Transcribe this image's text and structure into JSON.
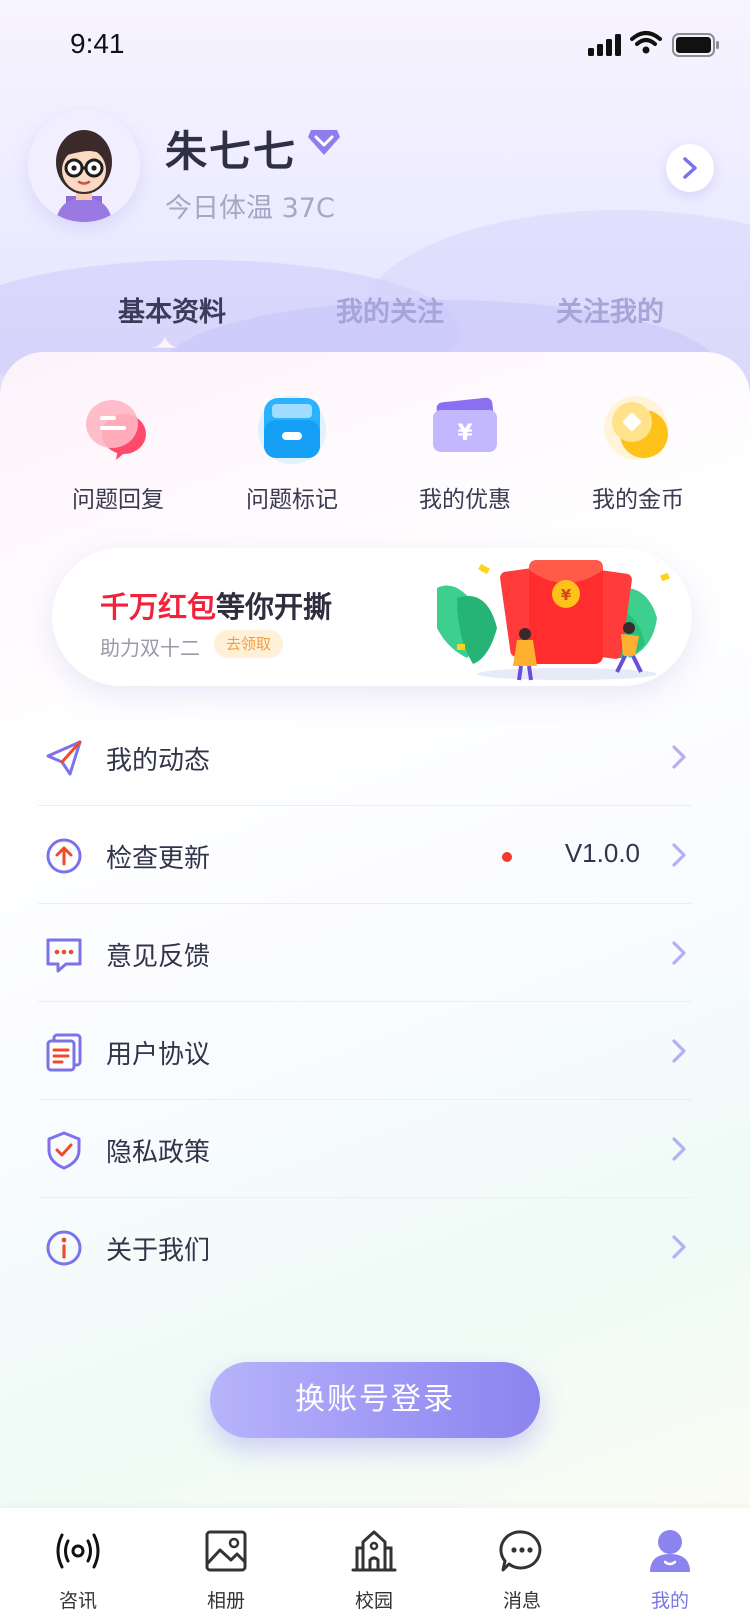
{
  "status_bar": {
    "time": "9:41"
  },
  "profile": {
    "name": "朱七七",
    "temperature": "今日体温 37C"
  },
  "tabs": [
    {
      "label": "基本资料",
      "active": true
    },
    {
      "label": "我的关注",
      "active": false
    },
    {
      "label": "关注我的",
      "active": false
    }
  ],
  "quick_actions": [
    {
      "label": "问题回复",
      "icon": "chat-bubbles-icon"
    },
    {
      "label": "问题标记",
      "icon": "inbox-tray-icon"
    },
    {
      "label": "我的优惠",
      "icon": "coupon-icon"
    },
    {
      "label": "我的金币",
      "icon": "gold-coin-icon"
    }
  ],
  "banner": {
    "title_red": "千万红包",
    "title_rest": "等你开撕",
    "subtitle": "助力双十二",
    "badge": "去领取"
  },
  "menu": [
    {
      "label": "我的动态",
      "icon": "paper-plane-icon",
      "value": ""
    },
    {
      "label": "检查更新",
      "icon": "upgrade-arrow-icon",
      "value": "V1.0.0"
    },
    {
      "label": "意见反馈",
      "icon": "feedback-message-icon",
      "value": ""
    },
    {
      "label": "用户协议",
      "icon": "document-icon",
      "value": ""
    },
    {
      "label": "隐私政策",
      "icon": "shield-check-icon",
      "value": ""
    },
    {
      "label": "关于我们",
      "icon": "info-icon",
      "value": ""
    }
  ],
  "switch_account_label": "换账号登录",
  "bottom_nav": [
    {
      "label": "咨讯",
      "icon": "broadcast-icon",
      "active": false
    },
    {
      "label": "相册",
      "icon": "image-icon",
      "active": false
    },
    {
      "label": "校园",
      "icon": "school-building-icon",
      "active": false
    },
    {
      "label": "消息",
      "icon": "message-bubble-icon",
      "active": false
    },
    {
      "label": "我的",
      "icon": "user-profile-icon",
      "active": true
    }
  ],
  "colors": {
    "accent": "#8b84ef",
    "accent_light": "#b7b4fb",
    "red": "#f3223c",
    "text_primary": "#33334a",
    "text_secondary": "#a7a7c3"
  }
}
